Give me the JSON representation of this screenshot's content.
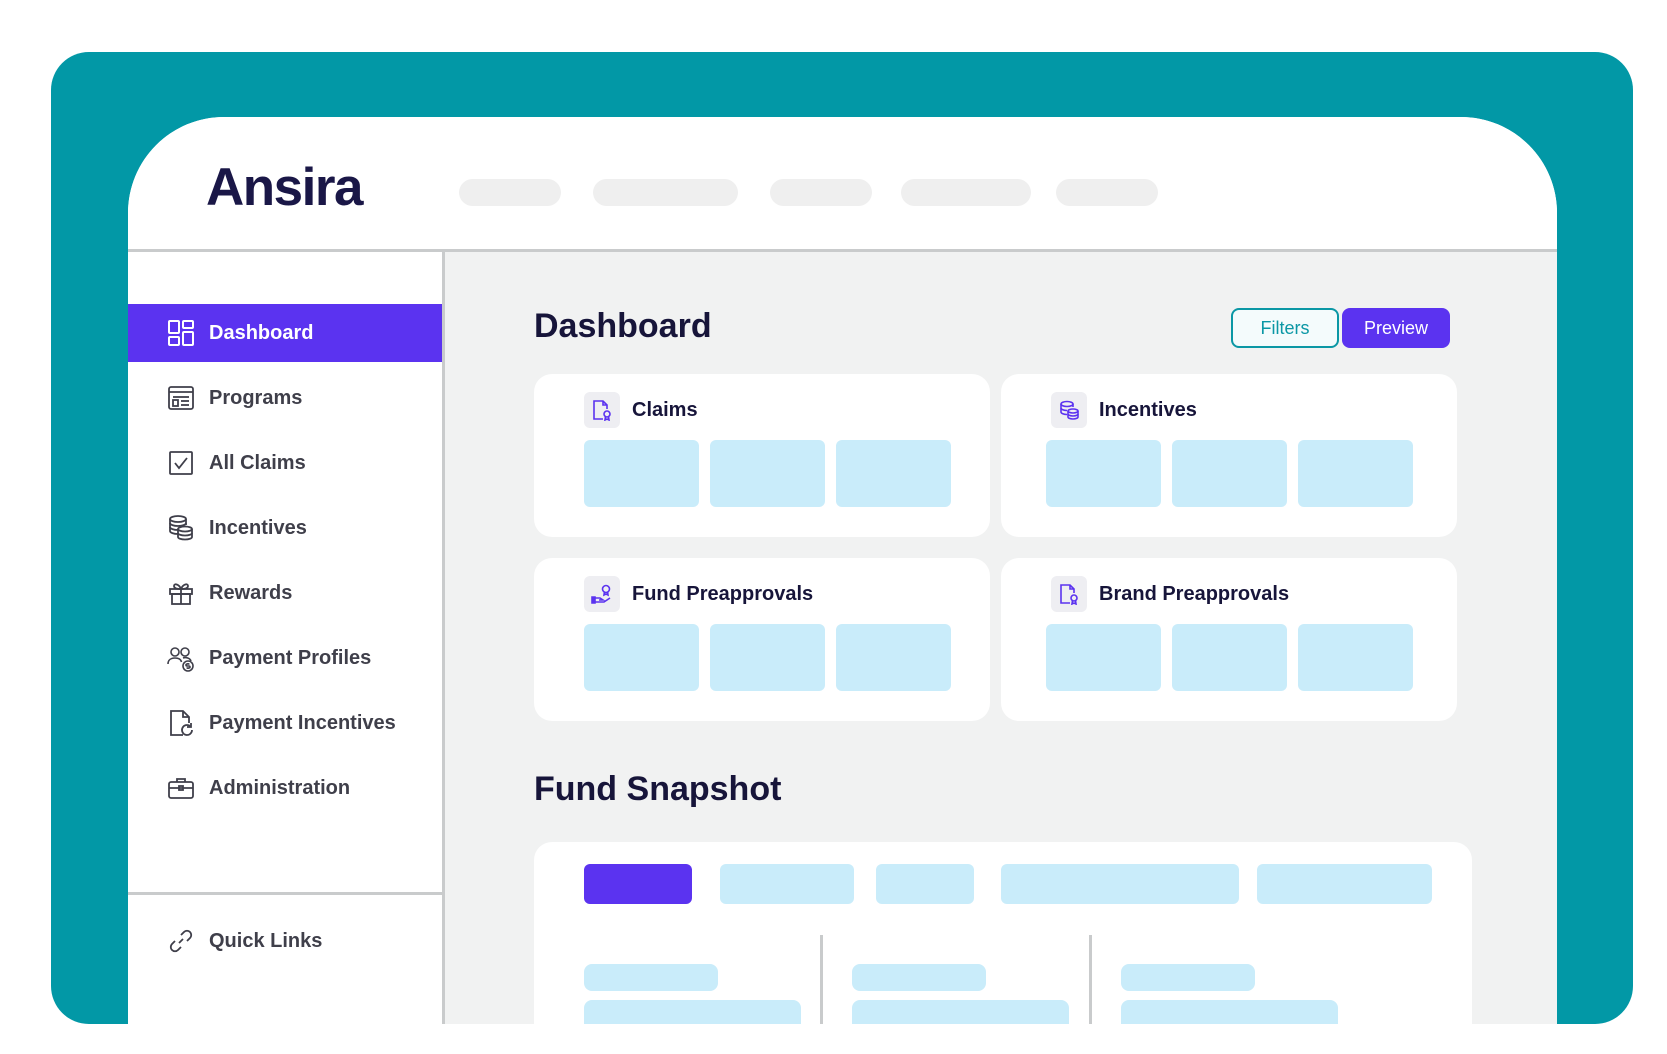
{
  "brand": {
    "logo_text": "Ansira",
    "frame_color": "#0298a6",
    "accent_color": "#5b33f0",
    "tile_color": "#c9ecfa"
  },
  "sidebar": {
    "items": [
      {
        "label": "Dashboard",
        "icon": "dashboard-grid-icon",
        "active": true
      },
      {
        "label": "Programs",
        "icon": "programs-window-icon"
      },
      {
        "label": "All Claims",
        "icon": "checkbox-icon"
      },
      {
        "label": "Incentives",
        "icon": "coins-stack-icon"
      },
      {
        "label": "Rewards",
        "icon": "gift-icon"
      },
      {
        "label": "Payment Profiles",
        "icon": "users-dollar-icon"
      },
      {
        "label": "Payment Incentives",
        "icon": "document-refresh-icon"
      },
      {
        "label": "Administration",
        "icon": "briefcase-icon"
      }
    ],
    "footer": {
      "label": "Quick Links",
      "icon": "link-icon"
    }
  },
  "main": {
    "title": "Dashboard",
    "filters_label": "Filters",
    "preview_label": "Preview",
    "cards": [
      {
        "title": "Claims",
        "icon": "claim-document-icon"
      },
      {
        "title": "Incentives",
        "icon": "coins-icon"
      },
      {
        "title": "Fund Preapprovals",
        "icon": "hand-approval-icon"
      },
      {
        "title": "Brand Preapprovals",
        "icon": "document-badge-icon"
      }
    ],
    "snapshot_title": "Fund Snapshot"
  }
}
